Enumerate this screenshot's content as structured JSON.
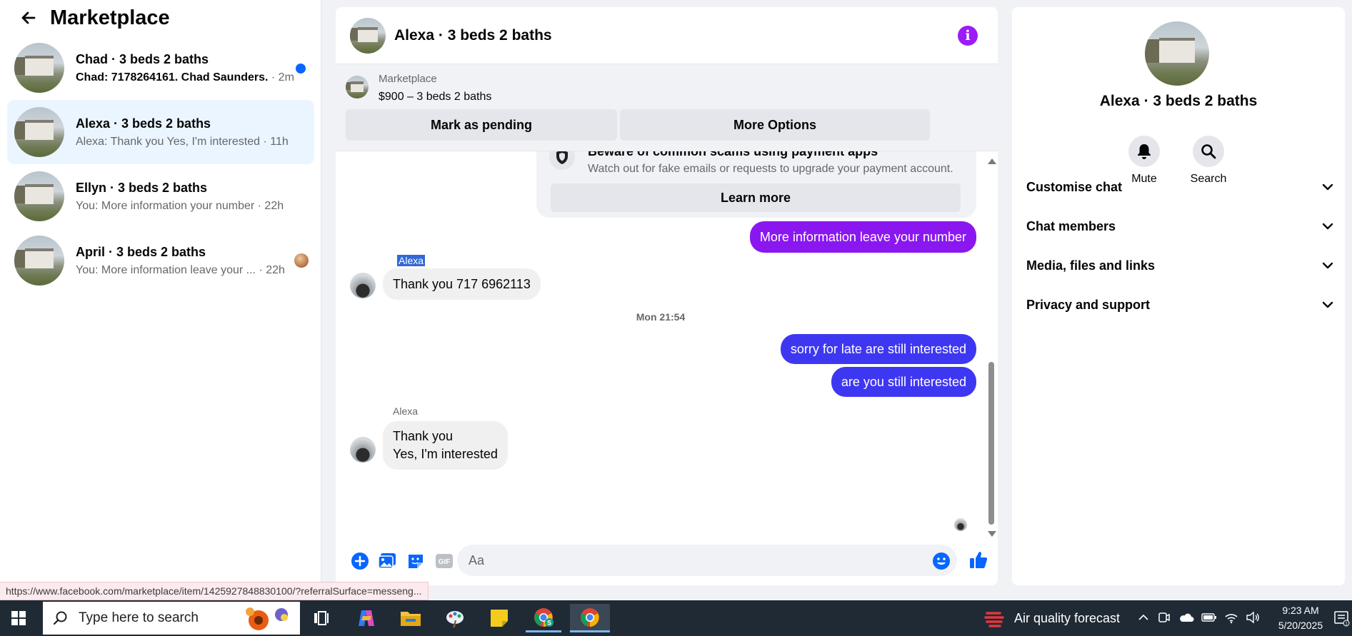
{
  "sidebar": {
    "title": "Marketplace",
    "conversations": [
      {
        "title": "Chad · 3 beds 2 baths",
        "preview": "Chad: 7178264161. Chad Saunders.",
        "time": "· 2m",
        "unread": true
      },
      {
        "title": "Alexa · 3 beds 2 baths",
        "preview": "Alexa: Thank you Yes, I'm interested",
        "time": "· 11h",
        "active": true
      },
      {
        "title": "Ellyn · 3 beds 2 baths",
        "preview": "You: More information your number",
        "time": "· 22h"
      },
      {
        "title": "April · 3 beds 2 baths",
        "preview": "You: More information leave your ...",
        "time": "· 22h"
      }
    ]
  },
  "chat": {
    "title": "Alexa · 3 beds 2 baths",
    "marketplace_label": "Marketplace",
    "listing": "$900 – 3 beds 2 baths",
    "mark_pending": "Mark as pending",
    "more_options": "More Options",
    "scam_title": "Beware of common scams using payment apps",
    "scam_sub": "Watch out for fake emails or requests to upgrade your payment account.",
    "learn_more": "Learn more",
    "messages": {
      "out1": "More information leave your number",
      "sender1": "Alexa",
      "in1": "Thank you 717 6962113",
      "timestamp": "Mon 21:54",
      "out2": "sorry for late are still interested",
      "out3": "are you still interested",
      "sender2": "Alexa",
      "in2_line1": "Thank you",
      "in2_line2": "Yes, I'm interested"
    },
    "composer_placeholder": "Aa"
  },
  "rpanel": {
    "title": "Alexa · 3 beds 2 baths",
    "mute": "Mute",
    "search": "Search",
    "rows": [
      "Customise chat",
      "Chat members",
      "Media, files and links",
      "Privacy and support"
    ]
  },
  "status_url": "https://www.facebook.com/marketplace/item/1425927848830100/?referralSurface=messeng...",
  "taskbar": {
    "search_placeholder": "Type here to search",
    "weather": "Air quality forecast",
    "time": "9:23 AM",
    "date": "5/20/2025"
  },
  "colors": {
    "accent_purple": "#8a17f0",
    "accent_blue": "#3e37f2",
    "unread_dot": "#0866ff",
    "info_icon": "#9b1cf7"
  }
}
